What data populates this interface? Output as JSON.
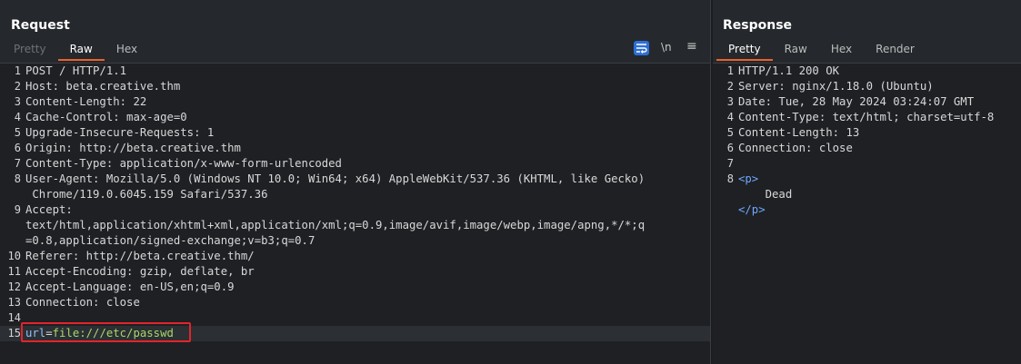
{
  "request": {
    "title": "Request",
    "tabs": [
      "Pretty",
      "Raw",
      "Hex"
    ],
    "active_tab": "Raw",
    "tools": {
      "newline": "\\n",
      "menu": "≡"
    },
    "lines": [
      {
        "n": "1",
        "text": "POST / HTTP/1.1"
      },
      {
        "n": "2",
        "text": "Host: beta.creative.thm"
      },
      {
        "n": "3",
        "text": "Content-Length: 22"
      },
      {
        "n": "4",
        "text": "Cache-Control: max-age=0"
      },
      {
        "n": "5",
        "text": "Upgrade-Insecure-Requests: 1"
      },
      {
        "n": "6",
        "text": "Origin: http://beta.creative.thm"
      },
      {
        "n": "7",
        "text": "Content-Type: application/x-www-form-urlencoded"
      },
      {
        "n": "8",
        "text": "User-Agent: Mozilla/5.0 (Windows NT 10.0; Win64; x64) AppleWebKit/537.36 (KHTML, like Gecko)"
      },
      {
        "n": "",
        "text": " Chrome/119.0.6045.159 Safari/537.36"
      },
      {
        "n": "9",
        "text": "Accept:"
      },
      {
        "n": "",
        "text": "text/html,application/xhtml+xml,application/xml;q=0.9,image/avif,image/webp,image/apng,*/*;q"
      },
      {
        "n": "",
        "text": "=0.8,application/signed-exchange;v=b3;q=0.7"
      },
      {
        "n": "10",
        "text": "Referer: http://beta.creative.thm/"
      },
      {
        "n": "11",
        "text": "Accept-Encoding: gzip, deflate, br"
      },
      {
        "n": "12",
        "text": "Accept-Language: en-US,en;q=0.9"
      },
      {
        "n": "13",
        "text": "Connection: close"
      },
      {
        "n": "14",
        "text": ""
      }
    ],
    "body_line": {
      "n": "15",
      "key": "url",
      "eq": "=",
      "value": "file:///etc/passwd"
    }
  },
  "response": {
    "title": "Response",
    "tabs": [
      "Pretty",
      "Raw",
      "Hex",
      "Render"
    ],
    "active_tab": "Pretty",
    "lines": [
      {
        "n": "1",
        "text": "HTTP/1.1 200 OK"
      },
      {
        "n": "2",
        "text": "Server: nginx/1.18.0 (Ubuntu)"
      },
      {
        "n": "3",
        "text": "Date: Tue, 28 May 2024 03:24:07 GMT"
      },
      {
        "n": "4",
        "text": "Content-Type: text/html; charset=utf-8"
      },
      {
        "n": "5",
        "text": "Content-Length: 13"
      },
      {
        "n": "6",
        "text": "Connection: close"
      },
      {
        "n": "7",
        "text": ""
      }
    ],
    "html_open": "<p>",
    "html_text": "Dead",
    "html_close": "</p>",
    "html_line_n": "8"
  }
}
